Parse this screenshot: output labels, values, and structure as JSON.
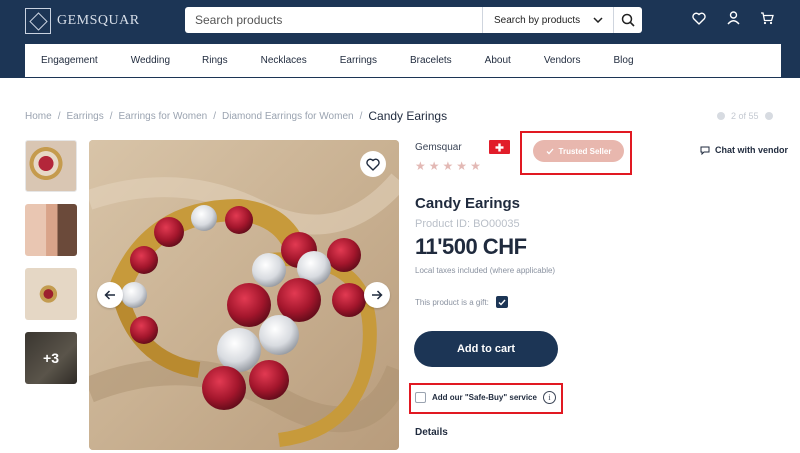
{
  "header": {
    "logo_text": "GEMSQUAR",
    "search": {
      "placeholder": "Search products",
      "scope_label": "Search by products"
    },
    "icons": [
      "heart-icon",
      "user-icon",
      "cart-icon"
    ],
    "colors": {
      "header_bg": "#1c3555",
      "accent_red": "#e11922"
    }
  },
  "nav": {
    "items": [
      "Engagement",
      "Wedding",
      "Rings",
      "Necklaces",
      "Earrings",
      "Bracelets",
      "About",
      "Vendors",
      "Blog"
    ]
  },
  "breadcrumb": {
    "items": [
      "Home",
      "Earrings",
      "Earrings for Women",
      "Diamond Earrings for Women"
    ],
    "current": "Candy Earings",
    "pager": "2 of 55"
  },
  "gallery": {
    "more_count": "+3"
  },
  "product": {
    "vendor": "Gemsquar",
    "rating": 5,
    "trusted_label": "Trusted Seller",
    "chat_label": "Chat with vendor",
    "title": "Candy Earings",
    "id_label": "Product ID: BO00035",
    "price": "11'500 CHF",
    "tax_note": "Local taxes included (where applicable)",
    "gift_label": "This product is a gift:",
    "gift_checked": true,
    "cart_label": "Add to cart",
    "safebuy_label": "Add our \"Safe-Buy\" service",
    "safebuy_checked": false,
    "details_label": "Details"
  }
}
